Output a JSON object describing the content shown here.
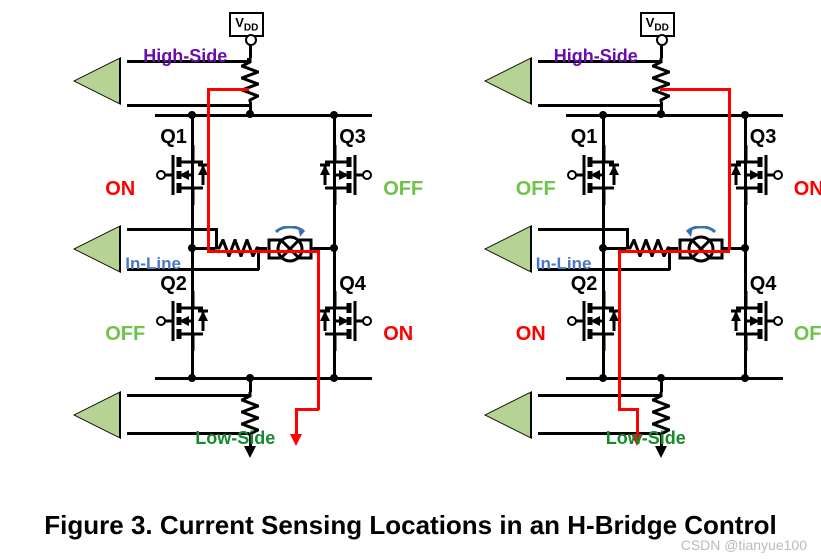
{
  "caption": "Figure 3. Current Sensing Locations in an H-Bridge Control",
  "watermark": "CSDN @tianyue100",
  "vdd": "VDD",
  "labels": {
    "high_side": "High-Side",
    "in_line": "In-Line",
    "low_side": "Low-Side"
  },
  "q": {
    "q1": "Q1",
    "q2": "Q2",
    "q3": "Q3",
    "q4": "Q4"
  },
  "states_left": {
    "q1": "ON",
    "q2": "OFF",
    "q3": "OFF",
    "q4": "ON"
  },
  "states_right": {
    "q1": "OFF",
    "q2": "ON",
    "q3": "ON",
    "q4": "OFF"
  },
  "colors_left": {
    "q1": "red-t",
    "q2": "grn-t",
    "q3": "grn-t",
    "q4": "red-t"
  },
  "colors_right": {
    "q1": "grn-t",
    "q2": "red-t",
    "q3": "red-t",
    "q4": "grn-t"
  }
}
